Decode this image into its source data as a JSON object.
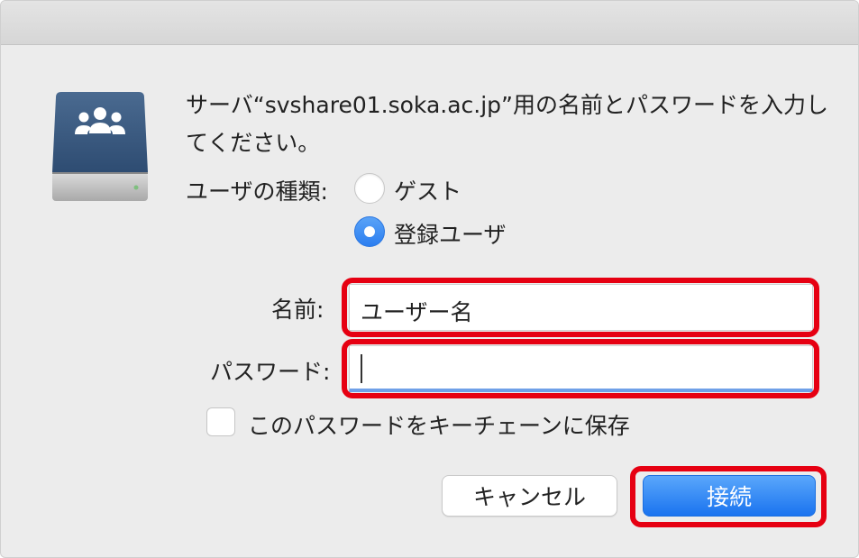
{
  "dialog": {
    "message": "サーバ“svshare01.soka.ac.jp”用の名前とパスワードを入力してください。",
    "user_type_label": "ユーザの種類:",
    "options": {
      "guest": "ゲスト",
      "registered": "登録ユーザ"
    },
    "selected_option": "登録ユーザ",
    "name_label": "名前:",
    "name_value": "ユーザー名",
    "password_label": "パスワード:",
    "password_value": "",
    "remember_label": "このパスワードをキーチェーンに保存",
    "remember_checked": false,
    "cancel_label": "キャンセル",
    "connect_label": "接続"
  },
  "colors": {
    "highlight": "#e60012",
    "accent": "#2b7ef0",
    "window_bg": "#ececec"
  },
  "icons": {
    "server": "shared-server-drive-icon"
  }
}
